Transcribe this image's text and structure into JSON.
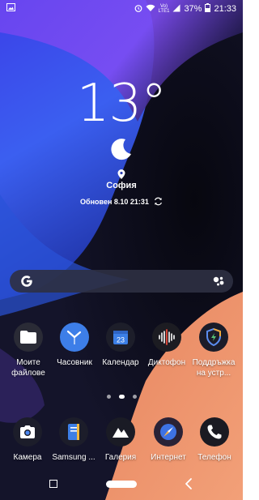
{
  "status_bar": {
    "volte_label": "Vo)",
    "lte_label": "LTE1",
    "battery_percent": "37%",
    "time": "21:33"
  },
  "weather": {
    "temperature": "13°",
    "city": "София",
    "updated": "Обновен 8.10 21:31"
  },
  "calendar_date": "23",
  "home_apps": [
    {
      "label": "Моите\nфайлове",
      "icon": "folder-icon"
    },
    {
      "label": "Часовник",
      "icon": "clock-icon"
    },
    {
      "label": "Календар",
      "icon": "calendar-icon"
    },
    {
      "label": "Диктофон",
      "icon": "voice-recorder-icon"
    },
    {
      "label": "Поддръжка на устр...",
      "icon": "device-care-icon"
    }
  ],
  "dock_apps": [
    {
      "label": "Камера",
      "icon": "camera-icon"
    },
    {
      "label": "Samsung ...",
      "icon": "samsung-notes-icon"
    },
    {
      "label": "Галерия",
      "icon": "gallery-icon"
    },
    {
      "label": "Интернет",
      "icon": "internet-icon"
    },
    {
      "label": "Телефон",
      "icon": "phone-icon"
    }
  ],
  "pager": {
    "pages": 3,
    "active": 1
  }
}
